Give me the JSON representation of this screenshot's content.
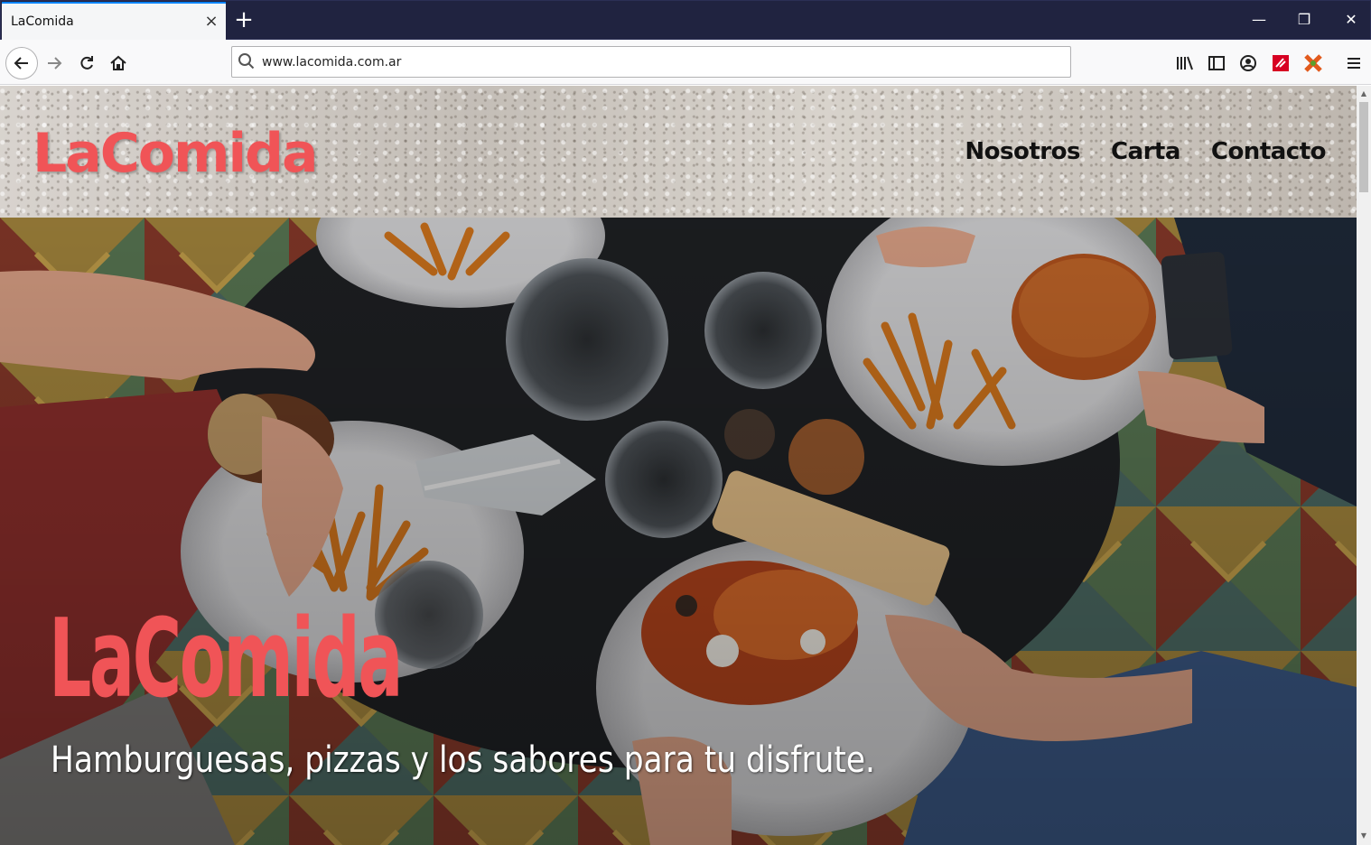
{
  "browser": {
    "tab_title": "LaComida",
    "tab_close": "×",
    "new_tab": "+",
    "url": "www.lacomida.com.ar",
    "window_controls": {
      "minimize": "—",
      "restore": "❐",
      "close": "✕"
    },
    "toolbar_icons": [
      "library-icon",
      "sidebar-icon",
      "account-icon",
      "pocket-icon",
      "extension-icon",
      "menu-icon"
    ]
  },
  "site": {
    "brand": "LaComida",
    "menu": [
      "Nosotros",
      "Carta",
      "Contacto"
    ],
    "hero": {
      "title": "LaComida",
      "subtitle": "Hamburguesas, pizzas y los sabores para tu disfrute."
    }
  },
  "colors": {
    "brand_red": "#f05457",
    "titlebar": "#202340",
    "tab_accent": "#0a84ff"
  }
}
